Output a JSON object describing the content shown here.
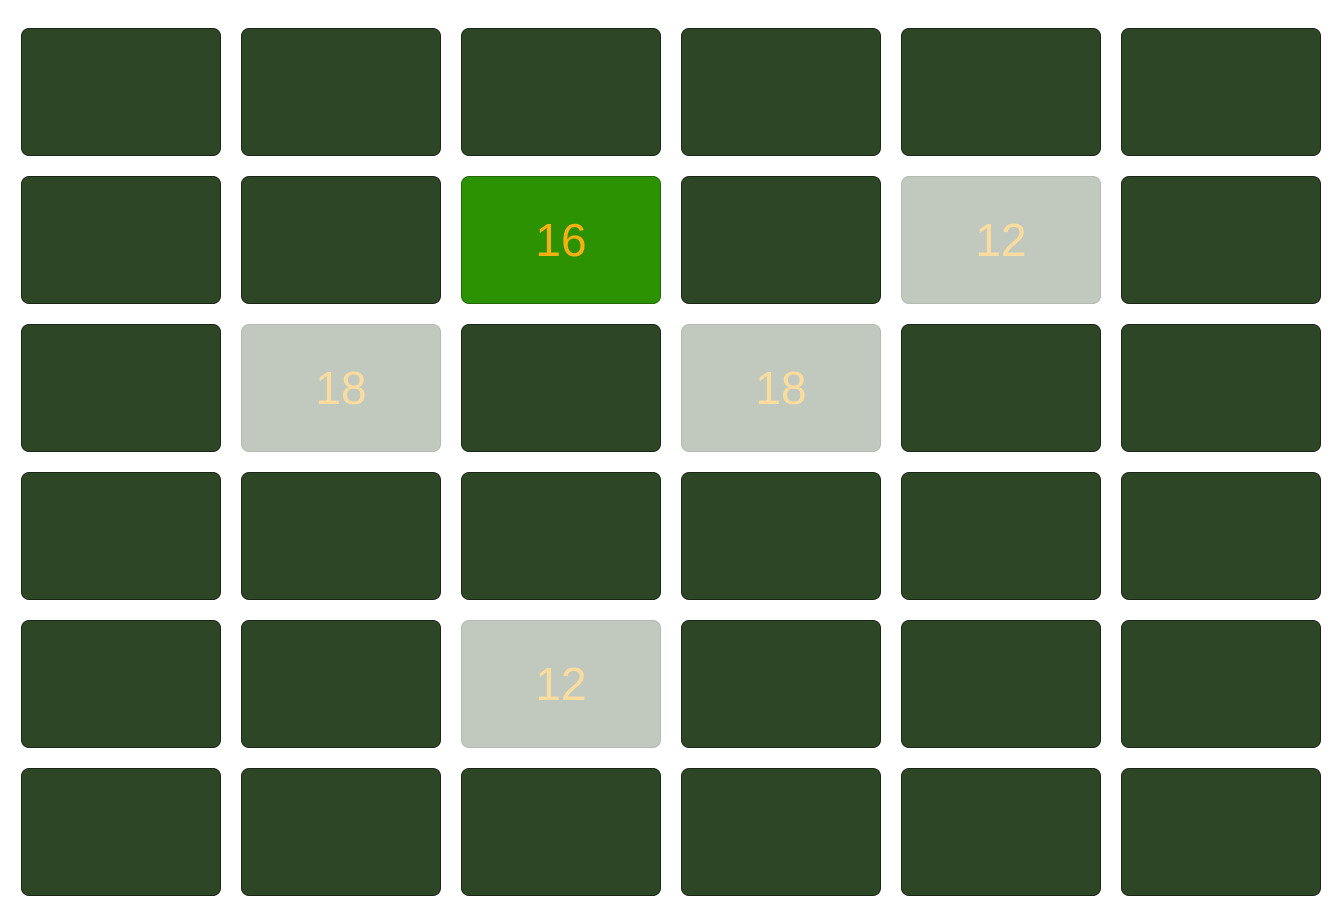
{
  "board": {
    "rows": 6,
    "cols": 6,
    "colors": {
      "hidden": "#2d4625",
      "revealed": "#c1c8be",
      "revealed_text": "#fbdc9f",
      "selected": "#2c9202",
      "selected_text": "#f6b012"
    },
    "tiles": [
      {
        "state": "hidden",
        "value": ""
      },
      {
        "state": "hidden",
        "value": ""
      },
      {
        "state": "hidden",
        "value": ""
      },
      {
        "state": "hidden",
        "value": ""
      },
      {
        "state": "hidden",
        "value": ""
      },
      {
        "state": "hidden",
        "value": ""
      },
      {
        "state": "hidden",
        "value": ""
      },
      {
        "state": "hidden",
        "value": ""
      },
      {
        "state": "selected",
        "value": "16"
      },
      {
        "state": "hidden",
        "value": ""
      },
      {
        "state": "revealed",
        "value": "12"
      },
      {
        "state": "hidden",
        "value": ""
      },
      {
        "state": "hidden",
        "value": ""
      },
      {
        "state": "revealed",
        "value": "18"
      },
      {
        "state": "hidden",
        "value": ""
      },
      {
        "state": "revealed",
        "value": "18"
      },
      {
        "state": "hidden",
        "value": ""
      },
      {
        "state": "hidden",
        "value": ""
      },
      {
        "state": "hidden",
        "value": ""
      },
      {
        "state": "hidden",
        "value": ""
      },
      {
        "state": "hidden",
        "value": ""
      },
      {
        "state": "hidden",
        "value": ""
      },
      {
        "state": "hidden",
        "value": ""
      },
      {
        "state": "hidden",
        "value": ""
      },
      {
        "state": "hidden",
        "value": ""
      },
      {
        "state": "hidden",
        "value": ""
      },
      {
        "state": "revealed",
        "value": "12"
      },
      {
        "state": "hidden",
        "value": ""
      },
      {
        "state": "hidden",
        "value": ""
      },
      {
        "state": "hidden",
        "value": ""
      },
      {
        "state": "hidden",
        "value": ""
      },
      {
        "state": "hidden",
        "value": ""
      },
      {
        "state": "hidden",
        "value": ""
      },
      {
        "state": "hidden",
        "value": ""
      },
      {
        "state": "hidden",
        "value": ""
      },
      {
        "state": "hidden",
        "value": ""
      }
    ]
  }
}
